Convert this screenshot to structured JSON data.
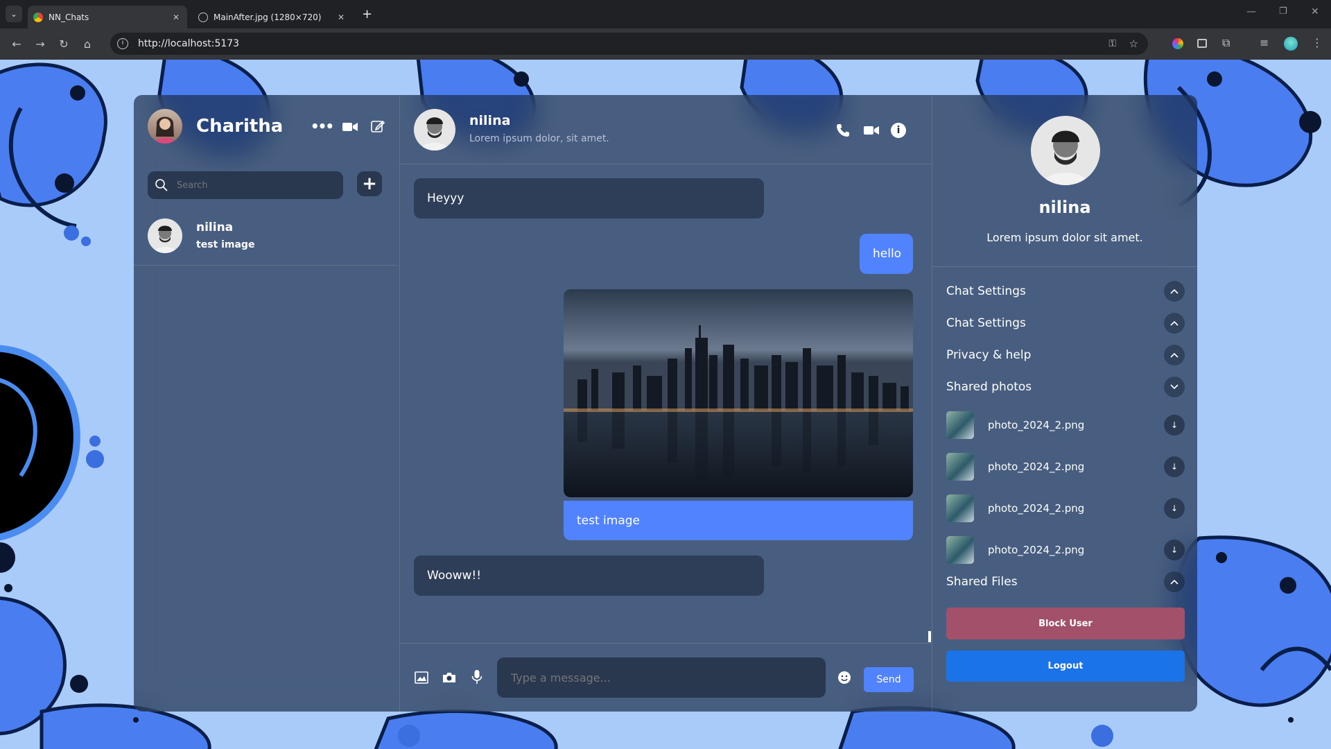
{
  "browser": {
    "tabs": [
      {
        "title": "NN_Chats",
        "active": true
      },
      {
        "title": "MainAfter.jpg (1280×720)",
        "active": false
      }
    ],
    "url": "http://localhost:5173"
  },
  "sidebar": {
    "user_name": "Charitha",
    "search_placeholder": "Search",
    "chats": [
      {
        "name": "nilina",
        "last_message": "test image"
      }
    ]
  },
  "chat": {
    "contact_name": "nilina",
    "contact_status": "Lorem ipsum dolor, sit amet.",
    "messages": [
      {
        "direction": "in",
        "text": "Heyyy"
      },
      {
        "direction": "out",
        "text": "hello"
      },
      {
        "direction": "out",
        "image": "city skyline at night",
        "text": "test image"
      },
      {
        "direction": "in",
        "text": "Wooww!!"
      }
    ],
    "input_placeholder": "Type a message...",
    "send_label": "Send"
  },
  "detail": {
    "name": "nilina",
    "bio": "Lorem ipsum dolor sit amet.",
    "sections": [
      {
        "label": "Chat Settings",
        "expanded": false
      },
      {
        "label": "Chat Settings",
        "expanded": false
      },
      {
        "label": "Privacy & help",
        "expanded": false
      },
      {
        "label": "Shared photos",
        "expanded": true
      }
    ],
    "shared_photos": [
      "photo_2024_2.png",
      "photo_2024_2.png",
      "photo_2024_2.png",
      "photo_2024_2.png"
    ],
    "shared_files_label": "Shared Files",
    "block_label": "Block User",
    "logout_label": "Logout"
  },
  "colors": {
    "accent": "#5183fe",
    "block": "#a3506a",
    "logout": "#1a73e8"
  }
}
